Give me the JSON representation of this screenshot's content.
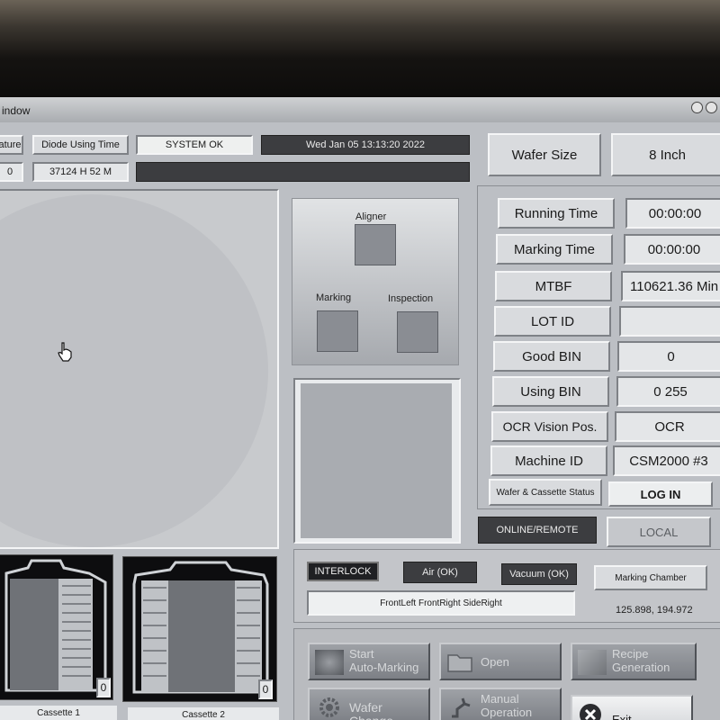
{
  "window": {
    "title": "indow"
  },
  "header": {
    "temperature_label": "ature",
    "temperature_value": "0",
    "diode_label": "Diode Using Time",
    "diode_value": "37124 H 52 M",
    "system_status": "SYSTEM OK",
    "datetime": "Wed Jan 05 13:13:20 2022",
    "message": ""
  },
  "wafer_size": {
    "label": "Wafer Size",
    "value": "8 Inch"
  },
  "status_rows": [
    {
      "label": "Running Time",
      "value": "00:00:00"
    },
    {
      "label": "Marking Time",
      "value": "00:00:00"
    },
    {
      "label": "MTBF",
      "value": "110621.36 Min"
    },
    {
      "label": "LOT ID",
      "value": ""
    },
    {
      "label": "Good BIN",
      "value": "0"
    },
    {
      "label": "Using BIN",
      "value": "0 255"
    },
    {
      "label": "OCR Vision Pos.",
      "value": "OCR"
    },
    {
      "label": "Machine ID",
      "value": "CSM2000 #3"
    }
  ],
  "wafer_cassette_status": "Wafer & Cassette Status",
  "login": "LOG IN",
  "mode": {
    "online": "ONLINE/REMOTE",
    "local": "LOCAL"
  },
  "stations": {
    "aligner": "Aligner",
    "marking": "Marking",
    "inspection": "Inspection"
  },
  "cassettes": [
    {
      "label": "Cassette 1",
      "count": "0"
    },
    {
      "label": "Cassette 2",
      "count": "0"
    }
  ],
  "interlock": {
    "interlock": "INTERLOCK",
    "air": "Air (OK)",
    "vacuum": "Vacuum (OK)",
    "chamber": "Marking Chamber",
    "doors": "FrontLeft FrontRight SideRight",
    "coords": "125.898, 194.972"
  },
  "actions": {
    "start": [
      "Start",
      "Auto-Marking"
    ],
    "open": "Open",
    "recipe": [
      "Recipe",
      "Generation"
    ],
    "wafer_change": "Wafer Change",
    "manual": [
      "Manual",
      "Operation"
    ],
    "exit": "Exit"
  },
  "colors": {
    "screen_bg": "#bcbfc4",
    "dark_field": "#3c3d40",
    "button": "#8f9297"
  }
}
